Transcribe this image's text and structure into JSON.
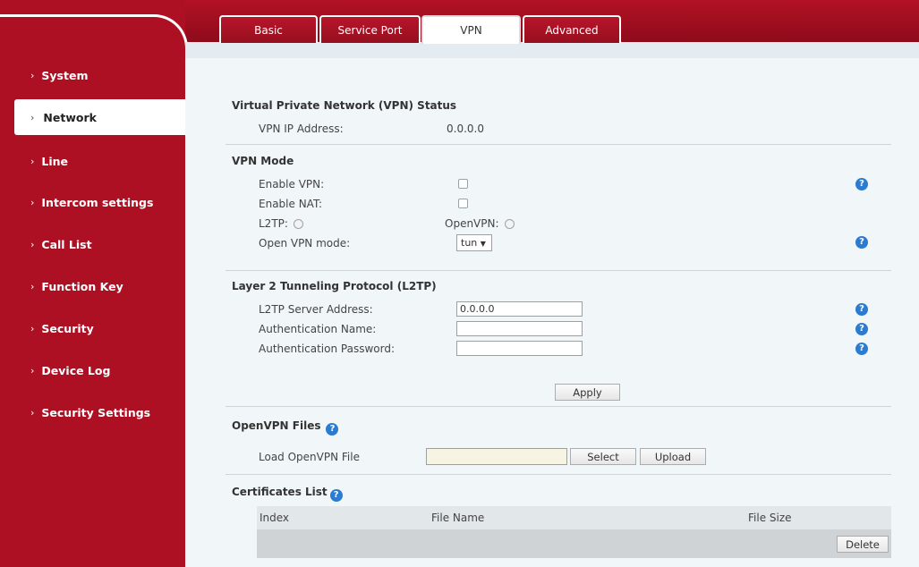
{
  "tabs": [
    {
      "label": "Basic"
    },
    {
      "label": "Service Port"
    },
    {
      "label": "VPN"
    },
    {
      "label": "Advanced"
    }
  ],
  "sidebar": {
    "items": [
      {
        "label": "System"
      },
      {
        "label": "Network"
      },
      {
        "label": "Line"
      },
      {
        "label": "Intercom settings"
      },
      {
        "label": "Call List"
      },
      {
        "label": "Function Key"
      },
      {
        "label": "Security"
      },
      {
        "label": "Device Log"
      },
      {
        "label": "Security Settings"
      }
    ]
  },
  "vpn_status": {
    "title": "Virtual Private Network (VPN) Status",
    "ip_label": "VPN IP Address:",
    "ip_value": "0.0.0.0"
  },
  "vpn_mode": {
    "title": "VPN Mode",
    "enable_vpn_label": "Enable VPN:",
    "enable_nat_label": "Enable NAT:",
    "l2tp_label": "L2TP:",
    "openvpn_label": "OpenVPN:",
    "openvpn_mode_label": "Open VPN mode:",
    "openvpn_mode_value": "tun"
  },
  "l2tp": {
    "title": "Layer 2 Tunneling Protocol (L2TP)",
    "server_label": "L2TP Server Address:",
    "server_value": "0.0.0.0",
    "auth_name_label": "Authentication Name:",
    "auth_name_value": "",
    "auth_password_label": "Authentication Password:",
    "auth_password_value": "",
    "apply_label": "Apply"
  },
  "openvpn_files": {
    "title": "OpenVPN Files",
    "load_label": "Load OpenVPN File",
    "select_label": "Select",
    "upload_label": "Upload"
  },
  "certificates": {
    "title": "Certificates List",
    "columns": [
      "Index",
      "File Name",
      "File Size"
    ],
    "delete_label": "Delete"
  },
  "colors": {
    "brand_red": "#ad1023",
    "help_blue": "#2b7bd0",
    "content_bg": "#f1f6f9"
  },
  "icons": {
    "help": "question-circle-icon",
    "nav_chevron": "chevron-right-icon",
    "dropdown": "caret-down-icon"
  }
}
